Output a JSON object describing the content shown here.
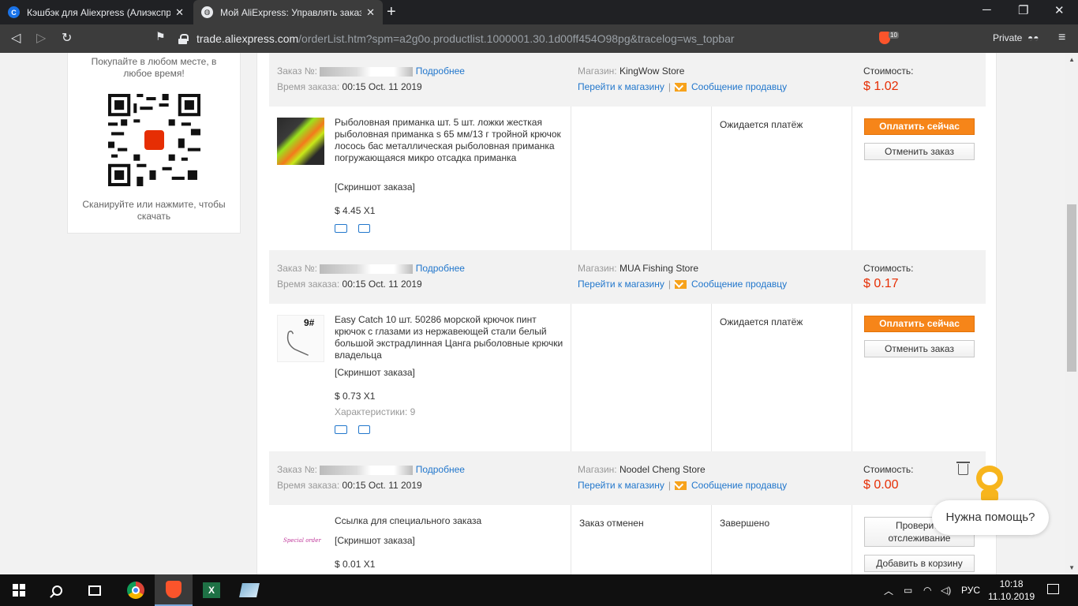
{
  "browser": {
    "tabs": [
      {
        "title": "Кэшбэк для Aliexpress (Алиэкспре",
        "favicon": "C"
      },
      {
        "title": "Мой AliExpress: Управлять заказа"
      }
    ],
    "url_host": "trade.aliexpress.com",
    "url_path": "/orderList.htm?spm=a2g0o.productlist.1000001.30.1d00ff454O98pg&tracelog=ws_topbar",
    "shield_count": "10",
    "private_label": "Private"
  },
  "sidebar": {
    "promo_top": "Покупайте в любом месте, в любое время!",
    "promo_bottom": "Сканируйте или нажмите, чтобы скачать"
  },
  "labels": {
    "order_no": "Заказ №:",
    "details": "Подробнее",
    "order_time": "Время заказа:",
    "store": "Магазин:",
    "go_store": "Перейти к магазину",
    "message_seller": "Сообщение продавцу",
    "cost": "Стоимость:",
    "screenshot": "[Скриншот заказа]",
    "specs": "Характеристики:"
  },
  "orders": [
    {
      "time": "00:15 Oct. 11 2019",
      "store": "KingWow Store",
      "total": "$ 1.02",
      "product": "Рыболовная приманка шт. 5 шт. ложки жесткая рыболовная приманка s 65 мм/13 г тройной крючок лосось бас металлическая рыболовная приманка погружающаяся микро отсадка приманка",
      "qty": "$ 4.45 X1",
      "status": "Ожидается платёж",
      "pay_label": "Оплатить сейчас",
      "cancel_label": "Отменить заказ"
    },
    {
      "time": "00:15 Oct. 11 2019",
      "store": "MUA Fishing Store",
      "total": "$ 0.17",
      "product": "Easy Catch 10 шт. 50286 морской крючок пинт крючок с глазами из нержавеющей стали белый большой экстрадлинная Цанга рыболовные крючки владельца",
      "qty": "$ 0.73 X1",
      "specs_value": "9",
      "thumb_label": "9#",
      "status": "Ожидается платёж",
      "pay_label": "Оплатить сейчас",
      "cancel_label": "Отменить заказ"
    },
    {
      "time": "00:15 Oct. 11 2019",
      "store": "Noodel Cheng Store",
      "total": "$ 0.00",
      "product": "Ссылка для специального заказа",
      "qty": "$ 0.01 X1",
      "thumb_label": "Special order",
      "detail_status": "Заказ отменен",
      "status": "Завершено",
      "track_label": "Проверить отслеживание",
      "cart_label": "Добавить в корзину"
    }
  ],
  "help_bubble": "Нужна помощь?",
  "taskbar": {
    "lang": "РУС",
    "time": "10:18",
    "date": "11.10.2019"
  },
  "colors": {
    "accent": "#e62e04",
    "pay_button": "#f68519",
    "link": "#2277cc"
  }
}
